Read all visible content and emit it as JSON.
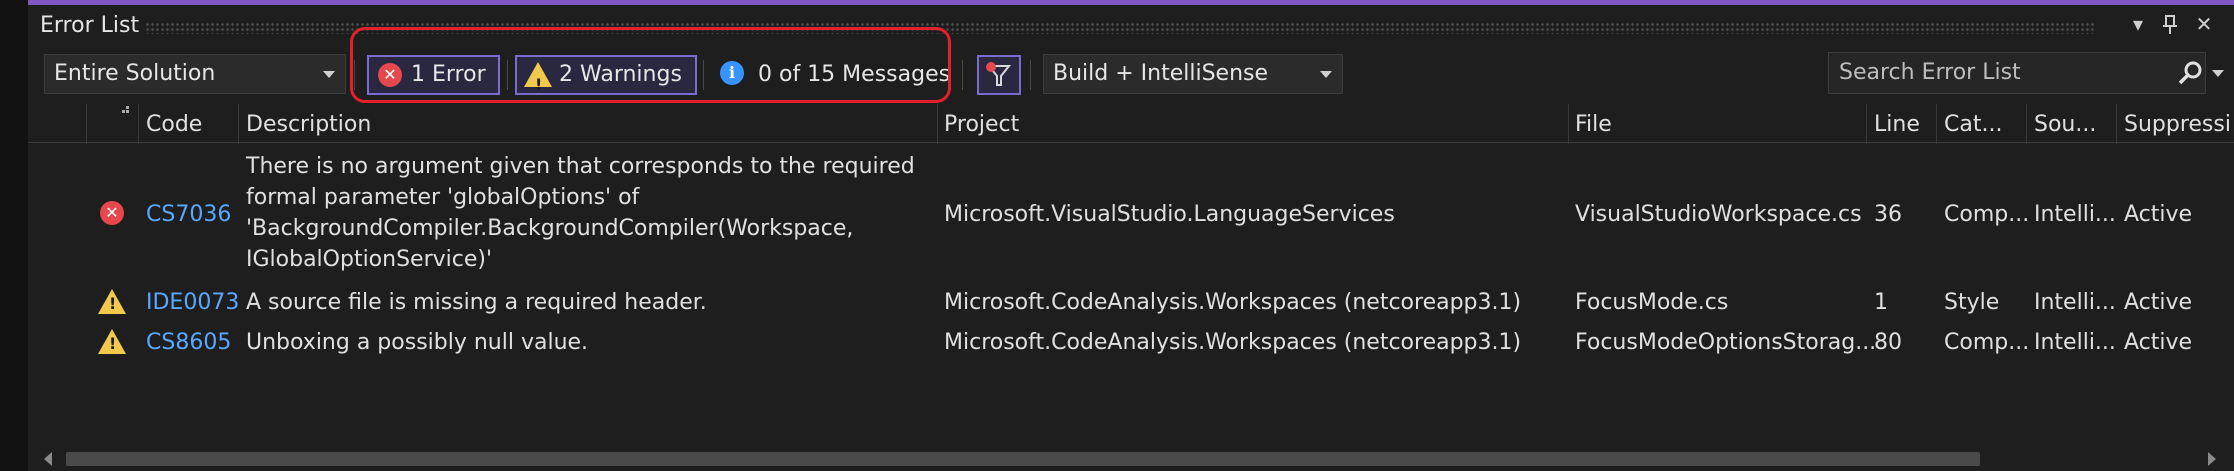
{
  "window": {
    "title": "Error List",
    "dropdown_icon": "chevron-down-icon",
    "pin_icon": "pin-icon",
    "close_icon": "close-icon"
  },
  "toolbar": {
    "scope": "Entire Solution",
    "errors_label": "1 Error",
    "warnings_label": "2 Warnings",
    "messages_label": "0 of 15 Messages",
    "build_filter": "Build + IntelliSense",
    "search_placeholder": "Search Error List"
  },
  "columns": {
    "code": "Code",
    "description": "Description",
    "project": "Project",
    "file": "File",
    "line": "Line",
    "category": "Cat...",
    "source": "Sou...",
    "suppression": "Suppressi"
  },
  "rows": [
    {
      "severity": "error",
      "code": "CS7036",
      "description_lines": [
        "There is no argument given that corresponds to the required",
        "formal parameter 'globalOptions' of",
        "'BackgroundCompiler.BackgroundCompiler(Workspace,",
        "IGlobalOptionService)'"
      ],
      "project": "Microsoft.VisualStudio.LanguageServices",
      "file": "VisualStudioWorkspace.cs",
      "line": "36",
      "category": "Comp...",
      "source": "Intelli...",
      "suppression": "Active"
    },
    {
      "severity": "warning",
      "code": "IDE0073",
      "description": "A source file is missing a required header.",
      "project": "Microsoft.CodeAnalysis.Workspaces (netcoreapp3.1)",
      "file": "FocusMode.cs",
      "line": "1",
      "category": "Style",
      "source": "Intelli...",
      "suppression": "Active"
    },
    {
      "severity": "warning",
      "code": "CS8605",
      "description": "Unboxing a possibly null value.",
      "project": "Microsoft.CodeAnalysis.Workspaces (netcoreapp3.1)",
      "file": "FocusModeOptionsStorag...",
      "line": "80",
      "category": "Comp...",
      "source": "Intelli...",
      "suppression": "Active"
    }
  ],
  "colors": {
    "accent": "#7e57c2",
    "error": "#e5484d",
    "warning": "#f2c94c",
    "info": "#3794ff",
    "link": "#59a8ff",
    "highlight": "#e3212b"
  }
}
